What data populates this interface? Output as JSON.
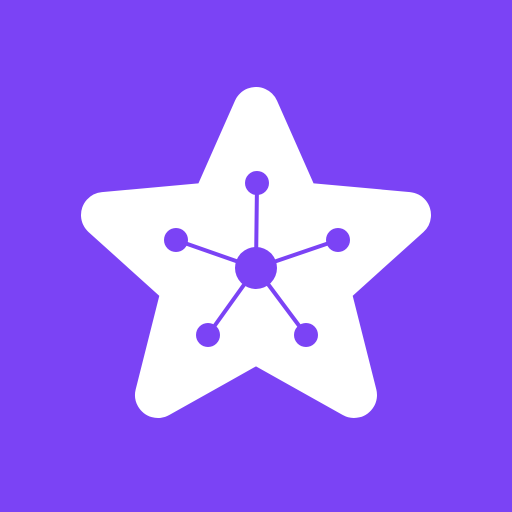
{
  "icon": {
    "name": "star-network-icon",
    "colors": {
      "background": "#7b43f5",
      "star": "#ffffff",
      "network": "#7b43f5"
    }
  }
}
